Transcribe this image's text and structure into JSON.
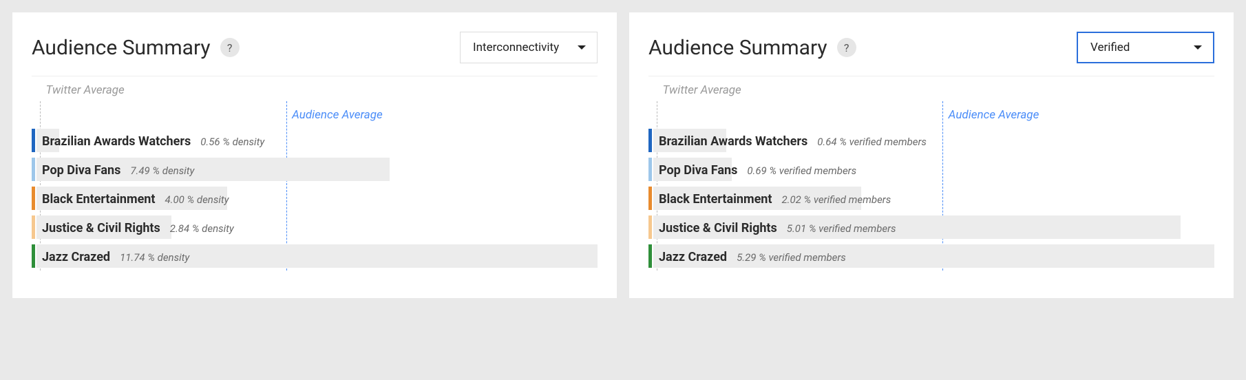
{
  "chart_data": [
    {
      "type": "bar",
      "title": "Audience Summary",
      "metric": "Interconnectivity",
      "unit_suffix": "% density",
      "categories": [
        "Brazilian Awards Watchers",
        "Pop Diva Fans",
        "Black Entertainment",
        "Justice & Civil Rights",
        "Jazz Crazed"
      ],
      "values": [
        0.56,
        7.49,
        4.0,
        2.84,
        11.74
      ],
      "reference_lines": {
        "Twitter Average": 0.4,
        "Audience Average": 5.3
      },
      "colors": [
        "#1f66c1",
        "#9ec7ea",
        "#e88b2e",
        "#f6c88f",
        "#2f8f3a"
      ],
      "xlim": [
        0,
        12
      ]
    },
    {
      "type": "bar",
      "title": "Audience Summary",
      "metric": "Verified",
      "unit_suffix": "% verified members",
      "categories": [
        "Brazilian Awards Watchers",
        "Pop Diva Fans",
        "Black Entertainment",
        "Justice & Civil Rights",
        "Jazz Crazed"
      ],
      "values": [
        0.64,
        0.69,
        2.02,
        5.01,
        5.29
      ],
      "reference_lines": {
        "Twitter Average": 0.3,
        "Audience Average": 2.8
      },
      "colors": [
        "#1f66c1",
        "#9ec7ea",
        "#e88b2e",
        "#f6c88f",
        "#2f8f3a"
      ],
      "xlim": [
        0,
        5.4
      ]
    }
  ],
  "panels": [
    {
      "title": "Audience Summary",
      "help_glyph": "?",
      "dropdown": {
        "selected": "Interconnectivity",
        "focused": false
      },
      "twitter_label": "Twitter Average",
      "audience_label": "Audience Average",
      "twitter_line_pct": 1.5,
      "audience_line_pct": 45.0,
      "rows": [
        {
          "name": "Brazilian Awards Watchers",
          "stat": "0.56 % density",
          "bar_pct": 4.0,
          "color": "#1f66c1"
        },
        {
          "name": "Pop Diva Fans",
          "stat": "7.49 % density",
          "bar_pct": 63.0,
          "color": "#9ec7ea"
        },
        {
          "name": "Black Entertainment",
          "stat": "4.00 % density",
          "bar_pct": 34.0,
          "color": "#e88b2e"
        },
        {
          "name": "Justice & Civil Rights",
          "stat": "2.84 % density",
          "bar_pct": 24.0,
          "color": "#f6c88f"
        },
        {
          "name": "Jazz Crazed",
          "stat": "11.74 % density",
          "bar_pct": 100.0,
          "color": "#2f8f3a"
        }
      ]
    },
    {
      "title": "Audience Summary",
      "help_glyph": "?",
      "dropdown": {
        "selected": "Verified",
        "focused": true
      },
      "twitter_label": "Twitter Average",
      "audience_label": "Audience Average",
      "twitter_line_pct": 1.5,
      "audience_line_pct": 52.0,
      "rows": [
        {
          "name": "Brazilian Awards Watchers",
          "stat": "0.64 % verified members",
          "bar_pct": 13.0,
          "color": "#1f66c1"
        },
        {
          "name": "Pop Diva Fans",
          "stat": "0.69 % verified members",
          "bar_pct": 14.0,
          "color": "#9ec7ea"
        },
        {
          "name": "Black Entertainment",
          "stat": "2.02 % verified members",
          "bar_pct": 37.0,
          "color": "#e88b2e"
        },
        {
          "name": "Justice & Civil Rights",
          "stat": "5.01 % verified members",
          "bar_pct": 94.0,
          "color": "#f6c88f"
        },
        {
          "name": "Jazz Crazed",
          "stat": "5.29 % verified members",
          "bar_pct": 100.0,
          "color": "#2f8f3a"
        }
      ]
    }
  ]
}
